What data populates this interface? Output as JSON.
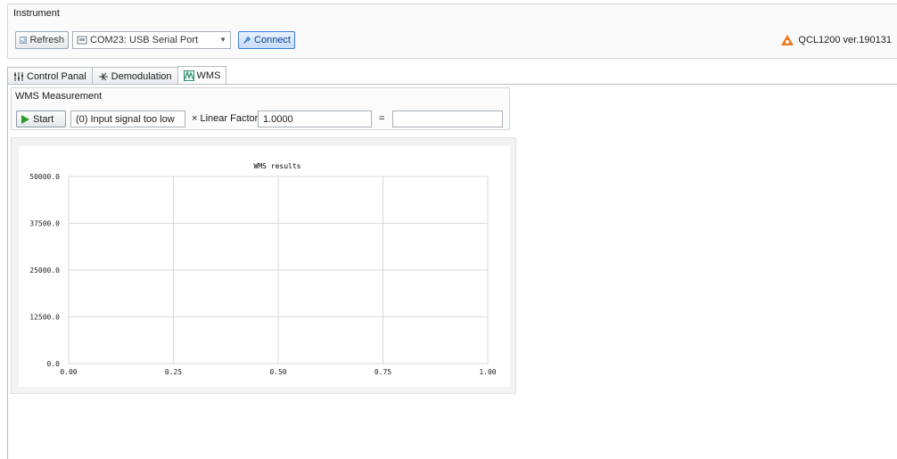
{
  "instrument": {
    "label": "Instrument",
    "refresh_label": "Refresh",
    "port_value": "COM23: USB Serial Port",
    "connect_label": "Connect",
    "version": "QCL1200 ver.190131"
  },
  "tabs": [
    {
      "label": "Control Panal",
      "icon": "sliders-icon"
    },
    {
      "label": "Demodulation",
      "icon": "demodulation-icon"
    },
    {
      "label": "WMS",
      "icon": "wave-icon",
      "active": true
    }
  ],
  "wms": {
    "group_label": "WMS Measurement",
    "start_label": "Start",
    "status_value": "(0) Input signal too low",
    "factor_label": "× Linear Factor",
    "factor_value": "1.0000",
    "equals_label": "=",
    "result_value": ""
  },
  "chart_data": {
    "type": "line",
    "title": "WMS results",
    "xlabel": "",
    "ylabel": "",
    "xlim": [
      0,
      1
    ],
    "ylim": [
      0,
      50000
    ],
    "x_ticks": [
      "0.00",
      "0.25",
      "0.50",
      "0.75",
      "1.00"
    ],
    "y_ticks": [
      "0.0",
      "12500.0",
      "25000.0",
      "37500.0",
      "50000.0"
    ],
    "grid": true,
    "series": []
  },
  "colors": {
    "accent": "#3d7bd9",
    "warning_icon": "#f07a1e",
    "start_green": "#2a9d2a",
    "grid": "#d8d8d8"
  }
}
